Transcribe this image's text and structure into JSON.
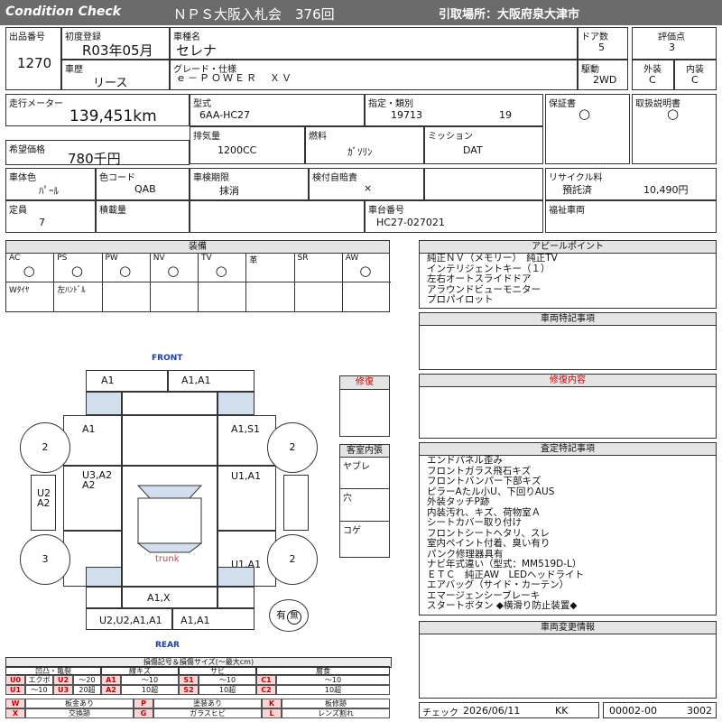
{
  "header": {
    "logo_text": "Condition  Check",
    "auction": "ＮＰＳ大阪入札会　376回",
    "pickup": "引取場所：大阪府泉大津市"
  },
  "info": {
    "lot_label": "出品番号",
    "lot": "1270",
    "first_reg_label": "初度登録",
    "first_reg": "R03年05月",
    "car_name_label": "車種名",
    "car_name": "セレナ",
    "doors_label": "ドア数",
    "doors": "5",
    "score_label": "評価点",
    "score": "3",
    "history_label": "車歴",
    "history": "リース",
    "grade_label": "グレード・仕様",
    "grade": "ｅ－ＰＯＷＥＲ　ＸＶ",
    "drive_label": "駆動",
    "drive": "2WD",
    "ext_label": "外装",
    "ext": "C",
    "int_label": "内装",
    "int": "C",
    "mileage_label": "走行メーター",
    "mileage": "139,451km",
    "model_label": "型式",
    "model": "6AA-HC27",
    "type_label": "指定・類別",
    "type1": "19713",
    "type2": "19",
    "warranty_label": "保証書",
    "warranty": "○",
    "manual_label": "取扱説明書",
    "manual": "○",
    "price_label": "希望価格",
    "price": "780千円",
    "displacement_label": "排気量",
    "displacement": "1200CC",
    "fuel_label": "燃料",
    "fuel": "ｶﾞｿﾘﾝ",
    "mission_label": "ミッション",
    "mission": "DAT",
    "body_color_label": "車体色",
    "body_color": "ﾊﾟｰﾙ",
    "color_code_label": "色コード",
    "color_code": "QAB",
    "inspection_label": "車検期限",
    "inspection": "抹消",
    "insurance_label": "検付自賠責",
    "insurance": "×",
    "recycle_label": "リサイクル料",
    "recycle_status": "預託済",
    "recycle_fee": "10,490円",
    "capacity_label": "定員",
    "capacity": "7",
    "load_label": "積載量",
    "load": "",
    "chassis_label": "車台番号",
    "chassis": "HC27-027021",
    "welfare_label": "福祉車両",
    "welfare": ""
  },
  "equipment": {
    "title": "装備",
    "row1": [
      {
        "label": "AC",
        "mark": "○"
      },
      {
        "label": "PS",
        "mark": "○"
      },
      {
        "label": "PW",
        "mark": "○"
      },
      {
        "label": "NV",
        "mark": "○"
      },
      {
        "label": "TV",
        "mark": "○"
      },
      {
        "label": "革",
        "mark": ""
      },
      {
        "label": "SR",
        "mark": ""
      },
      {
        "label": "AW",
        "mark": "○"
      }
    ],
    "row2": [
      "Wﾀｲﾔ",
      "左ﾊﾝﾄﾞﾙ",
      "",
      "",
      "",
      "",
      "",
      ""
    ]
  },
  "appeal": {
    "title": "アピールポイント",
    "lines": [
      "純正ＮＶ（メモリー）　純正TV",
      "インテリジェントキー（１）",
      "左右オートスライドドア",
      "アラウンドビューモニター",
      "プロパイロット"
    ]
  },
  "special": {
    "title": "車両特記事項"
  },
  "repair": {
    "title": "修復",
    "detail_title": "修復内容"
  },
  "cabin": {
    "title": "客室内張",
    "items": [
      "ヤブレ",
      "穴",
      "コゲ"
    ]
  },
  "inspect": {
    "title": "査定特記事項",
    "lines": [
      "エンドパネル歪み",
      "フロントガラス飛石キズ",
      "フロントバンパー下部キズ",
      "ピラーAたル小U、下回りAUS",
      "外装タッチP跡",
      "内装汚れ、キズ、荷物室Ａ",
      "シートカバー取り付け",
      "フロントシートヘタリ、スレ",
      "室内ペイント付着、臭い有り",
      "パンク修理器具有",
      "ナビ年式違い（型式：MM519D-L）",
      "ＥＴＣ　純正AW　LEDヘッドライト",
      "エアバッグ（サイド・カーテン）",
      "エマージェンシーブレーキ",
      "スタートボタン ◆横滑り防止装置◆"
    ]
  },
  "change": {
    "title": "車両変更情報"
  },
  "diagram": {
    "front": "FRONT",
    "rear": "REAR",
    "trunk": "trunk",
    "marks": {
      "top_left": "A1",
      "top_right": "A1,A1",
      "fender_l": "A1",
      "fender_r": "A1,S1",
      "door_fl": "U3,A2\nA2",
      "door_fr": "U1,A1",
      "side_l": "U2\nA2",
      "door_rr": "U1,A1",
      "rear_center": "A1,X",
      "bottom_left": "U2,U2,A1,A1",
      "bottom_right": "A1,A1"
    },
    "wheels": {
      "fl": "2",
      "fr": "2",
      "rl": "3",
      "rr": "2"
    },
    "spare_label": "有",
    "spare_mark": "無"
  },
  "legend": {
    "title": "損傷記号＆損傷サイズ(～最大cm)",
    "groups": [
      "凹凸・亀裂",
      "線キズ",
      "サビ",
      "腐食"
    ],
    "rows": [
      [
        {
          "k": "U0",
          "v": "エクボ"
        },
        {
          "k": "U2",
          "v": "～20"
        },
        {
          "k": "A1",
          "v": "～10"
        },
        {
          "k": "S1",
          "v": "～10"
        },
        {
          "k": "C1",
          "v": "～10"
        }
      ],
      [
        {
          "k": "U1",
          "v": "～10"
        },
        {
          "k": "U3",
          "v": "20超"
        },
        {
          "k": "A2",
          "v": "10超"
        },
        {
          "k": "S2",
          "v": "10超"
        },
        {
          "k": "C2",
          "v": "10超"
        }
      ]
    ],
    "codes": [
      [
        {
          "k": "W",
          "v": "板金あり"
        },
        {
          "k": "P",
          "v": "塗装あり"
        },
        {
          "k": "K",
          "v": "板修跡"
        }
      ],
      [
        {
          "k": "X",
          "v": "交換跡"
        },
        {
          "k": "G",
          "v": "ガラスヒビ"
        },
        {
          "k": "L",
          "v": "レンズ割れ"
        }
      ]
    ]
  },
  "footer": {
    "check_label": "チェック",
    "date": "2026/06/11",
    "inspector": "KK",
    "code1": "00002-00",
    "code2": "3002"
  }
}
